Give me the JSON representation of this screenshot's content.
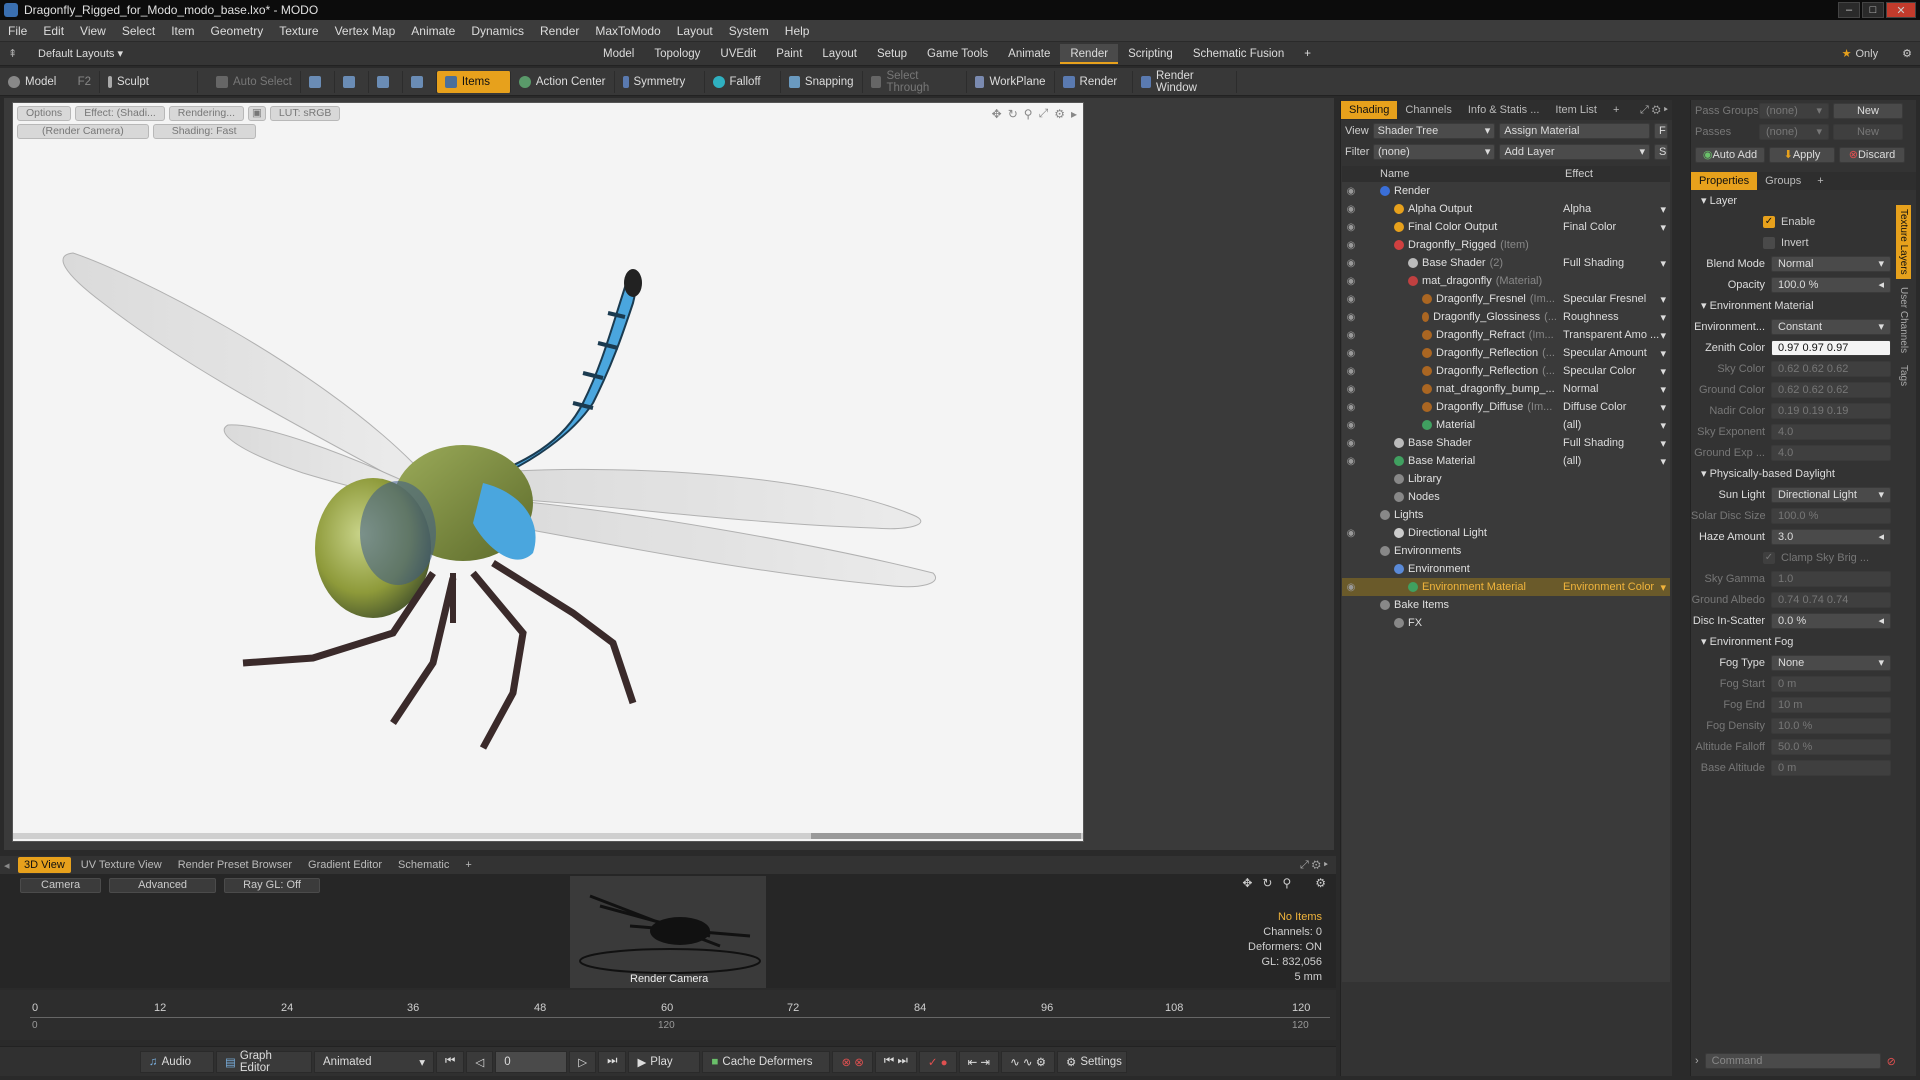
{
  "window": {
    "title": "Dragonfly_Rigged_for_Modo_modo_base.lxo* - MODO"
  },
  "menu": [
    "File",
    "Edit",
    "View",
    "Select",
    "Item",
    "Geometry",
    "Texture",
    "Vertex Map",
    "Animate",
    "Dynamics",
    "Render",
    "MaxToModo",
    "Layout",
    "System",
    "Help"
  ],
  "layoutbar": {
    "default_layouts": "Default Layouts",
    "tabs": [
      "Model",
      "Topology",
      "UVEdit",
      "Paint",
      "Layout",
      "Setup",
      "Game Tools",
      "Animate",
      "Render",
      "Scripting",
      "Schematic Fusion"
    ],
    "active": "Render",
    "only": "Only"
  },
  "toolbar": {
    "model": "Model",
    "f2": "F2",
    "sculpt": "Sculpt",
    "auto_select": "Auto Select",
    "items": "Items",
    "action_center": "Action Center",
    "symmetry": "Symmetry",
    "falloff": "Falloff",
    "snapping": "Snapping",
    "select_through": "Select Through",
    "workplane": "WorkPlane",
    "render": "Render",
    "render_window": "Render Window"
  },
  "viewport": {
    "tags_row1": [
      "Options",
      "Effect: (Shadi...",
      "Rendering...",
      "LUT: sRGB"
    ],
    "tags_row2": [
      "(Render Camera)",
      "Shading: Fast"
    ]
  },
  "bottom_tabs": [
    "3D View",
    "UV Texture View",
    "Render Preset Browser",
    "Gradient Editor",
    "Schematic"
  ],
  "preview": {
    "camera": "Camera",
    "advanced": "Advanced",
    "raygl": "Ray GL: Off",
    "caption": "Render Camera",
    "stats": [
      "No Items",
      "Channels: 0",
      "Deformers: ON",
      "GL: 832,056",
      "5 mm"
    ]
  },
  "timeline": {
    "ticks": [
      "0",
      "12",
      "24",
      "36",
      "48",
      "60",
      "72",
      "84",
      "96",
      "108",
      "120"
    ],
    "lower_ticks": [
      "0",
      "120",
      "120"
    ]
  },
  "transport": {
    "audio": "Audio",
    "graph_editor": "Graph Editor",
    "animated": "Animated",
    "frame": "0",
    "play": "Play",
    "cache_deformers": "Cache Deformers",
    "settings": "Settings"
  },
  "shading_panel": {
    "tabs": [
      "Shading",
      "Channels",
      "Info & Statis ...",
      "Item List"
    ],
    "view_label": "View",
    "view_value": "Shader Tree",
    "assign_material": "Assign Material",
    "f": "F",
    "filter_label": "Filter",
    "filter_value": "(none)",
    "add_layer": "Add Layer",
    "s": "S",
    "col_name": "Name",
    "col_effect": "Effect",
    "rows": [
      {
        "name": "Render",
        "sub": "",
        "effect": "",
        "indent": 0
      },
      {
        "name": "Alpha Output",
        "sub": "",
        "effect": "Alpha",
        "indent": 1
      },
      {
        "name": "Final Color Output",
        "sub": "",
        "effect": "Final Color",
        "indent": 1
      },
      {
        "name": "Dragonfly_Rigged",
        "sub": "(Item)",
        "effect": "",
        "indent": 1
      },
      {
        "name": "Base Shader",
        "sub": "(2)",
        "effect": "Full Shading",
        "indent": 2
      },
      {
        "name": "mat_dragonfly",
        "sub": "(Material)",
        "effect": "",
        "indent": 2
      },
      {
        "name": "Dragonfly_Fresnel",
        "sub": "(Im...",
        "effect": "Specular Fresnel",
        "indent": 3
      },
      {
        "name": "Dragonfly_Glossiness",
        "sub": "(...",
        "effect": "Roughness",
        "indent": 3
      },
      {
        "name": "Dragonfly_Refract",
        "sub": "(Im...",
        "effect": "Transparent Amo ...",
        "indent": 3
      },
      {
        "name": "Dragonfly_Reflection",
        "sub": "(...",
        "effect": "Specular Amount",
        "indent": 3
      },
      {
        "name": "Dragonfly_Reflection",
        "sub": "(...",
        "effect": "Specular Color",
        "indent": 3
      },
      {
        "name": "mat_dragonfly_bump_...",
        "sub": "",
        "effect": "Normal",
        "indent": 3
      },
      {
        "name": "Dragonfly_Diffuse",
        "sub": "(Im...",
        "effect": "Diffuse Color",
        "indent": 3
      },
      {
        "name": "Material",
        "sub": "",
        "effect": "(all)",
        "indent": 3
      },
      {
        "name": "Base Shader",
        "sub": "",
        "effect": "Full Shading",
        "indent": 1
      },
      {
        "name": "Base Material",
        "sub": "",
        "effect": "(all)",
        "indent": 1
      },
      {
        "name": "Library",
        "sub": "",
        "effect": "",
        "indent": 1
      },
      {
        "name": "Nodes",
        "sub": "",
        "effect": "",
        "indent": 1
      },
      {
        "name": "Lights",
        "sub": "",
        "effect": "",
        "indent": 0
      },
      {
        "name": "Directional Light",
        "sub": "",
        "effect": "",
        "indent": 1
      },
      {
        "name": "Environments",
        "sub": "",
        "effect": "",
        "indent": 0
      },
      {
        "name": "Environment",
        "sub": "",
        "effect": "",
        "indent": 1
      },
      {
        "name": "Environment Material",
        "sub": "",
        "effect": "Environment Color",
        "indent": 2
      },
      {
        "name": "Bake Items",
        "sub": "",
        "effect": "",
        "indent": 0
      },
      {
        "name": "FX",
        "sub": "",
        "effect": "",
        "indent": 1
      }
    ]
  },
  "properties": {
    "pass_groups": "Pass Groups",
    "pass_groups_value": "(none)",
    "new": "New",
    "passes": "Passes",
    "passes_value": "(none)",
    "new2": "New",
    "auto_add": "Auto Add",
    "apply": "Apply",
    "discard": "Discard",
    "tabs": [
      "Properties",
      "Groups"
    ],
    "layer": "Layer",
    "enable": "Enable",
    "invert": "Invert",
    "blend_mode": "Blend Mode",
    "blend_mode_value": "Normal",
    "opacity": "Opacity",
    "opacity_value": "100.0 %",
    "env_material": "Environment Material",
    "environment": "Environment...",
    "environment_value": "Constant",
    "zenith": "Zenith Color",
    "zenith_value": "0.97  0.97  0.97",
    "sky": "Sky Color",
    "sky_value": "0.62  0.62  0.62",
    "ground": "Ground Color",
    "ground_value": "0.62  0.62  0.62",
    "nadir": "Nadir Color",
    "nadir_value": "0.19  0.19  0.19",
    "sky_exp": "Sky Exponent",
    "sky_exp_value": "4.0",
    "ground_exp": "Ground Exp ...",
    "ground_exp_value": "4.0",
    "daylight": "Physically-based Daylight",
    "sun_light": "Sun Light",
    "sun_light_value": "Directional Light",
    "solar_disc": "Solar Disc Size",
    "solar_disc_value": "100.0 %",
    "haze": "Haze Amount",
    "haze_value": "3.0",
    "clamp": "Clamp Sky Brig ...",
    "sky_gamma": "Sky Gamma",
    "sky_gamma_value": "1.0",
    "ground_albedo": "Ground Albedo",
    "ground_albedo_value": "0.74  0.74  0.74",
    "disc_in": "Disc In-Scatter",
    "disc_in_value": "0.0 %",
    "fog": "Environment Fog",
    "fog_type": "Fog Type",
    "fog_type_value": "None",
    "fog_start": "Fog Start",
    "fog_start_value": "0 m",
    "fog_end": "Fog End",
    "fog_end_value": "10 m",
    "fog_density": "Fog Density",
    "fog_density_value": "10.0 %",
    "alt_falloff": "Altitude Falloff",
    "alt_falloff_value": "50.0 %",
    "base_alt": "Base Altitude",
    "base_alt_value": "0 m",
    "side_tabs": [
      "Texture Layers",
      "User Channels",
      "Tags"
    ],
    "command": "Command"
  }
}
